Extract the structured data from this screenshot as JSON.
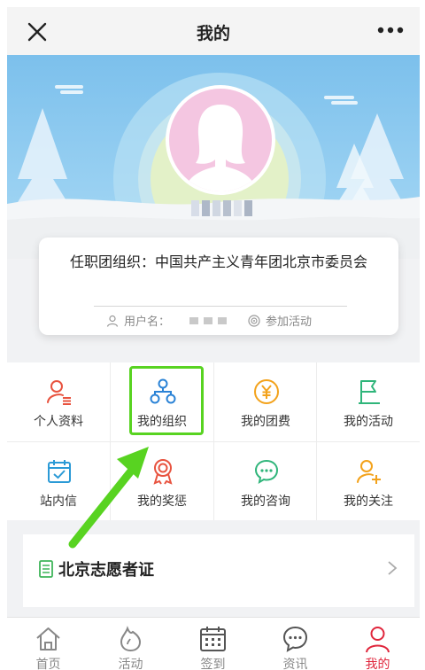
{
  "header": {
    "title": "我的",
    "close_icon": "close-icon",
    "more_icon": "more-icon"
  },
  "profile": {
    "avatar_icon": "female-avatar-icon",
    "username_display": "",
    "card": {
      "org_title": "任职团组织：中国共产主义青年团北京市委员会",
      "username_label": "用户名：",
      "activity_label": "参加活动"
    }
  },
  "menu": {
    "items": [
      {
        "label": "个人资料",
        "icon": "profile-icon",
        "color": "#e8533f"
      },
      {
        "label": "我的组织",
        "icon": "org-icon",
        "color": "#2b83d6"
      },
      {
        "label": "我的团费",
        "icon": "yen-icon",
        "color": "#f3a21b"
      },
      {
        "label": "我的活动",
        "icon": "flag-icon",
        "color": "#2fb57a"
      },
      {
        "label": "站内信",
        "icon": "calendar-check-icon",
        "color": "#2b9ad6"
      },
      {
        "label": "我的奖惩",
        "icon": "award-icon",
        "color": "#e8533f"
      },
      {
        "label": "我的咨询",
        "icon": "chat-icon",
        "color": "#2fb57a"
      },
      {
        "label": "我的关注",
        "icon": "user-add-icon",
        "color": "#f3a21b"
      }
    ]
  },
  "certificate": {
    "label": "北京志愿者证",
    "icon": "document-icon",
    "icon_color": "#3fb55a"
  },
  "tabbar": {
    "items": [
      {
        "label": "首页",
        "icon": "home-icon"
      },
      {
        "label": "活动",
        "icon": "flame-icon"
      },
      {
        "label": "签到",
        "icon": "calendar-icon"
      },
      {
        "label": "资讯",
        "icon": "chat-icon"
      },
      {
        "label": "我的",
        "icon": "user-icon"
      }
    ],
    "active_index": 4,
    "active_color": "#e0263c"
  },
  "annotation": {
    "highlight_color": "#58d321"
  }
}
